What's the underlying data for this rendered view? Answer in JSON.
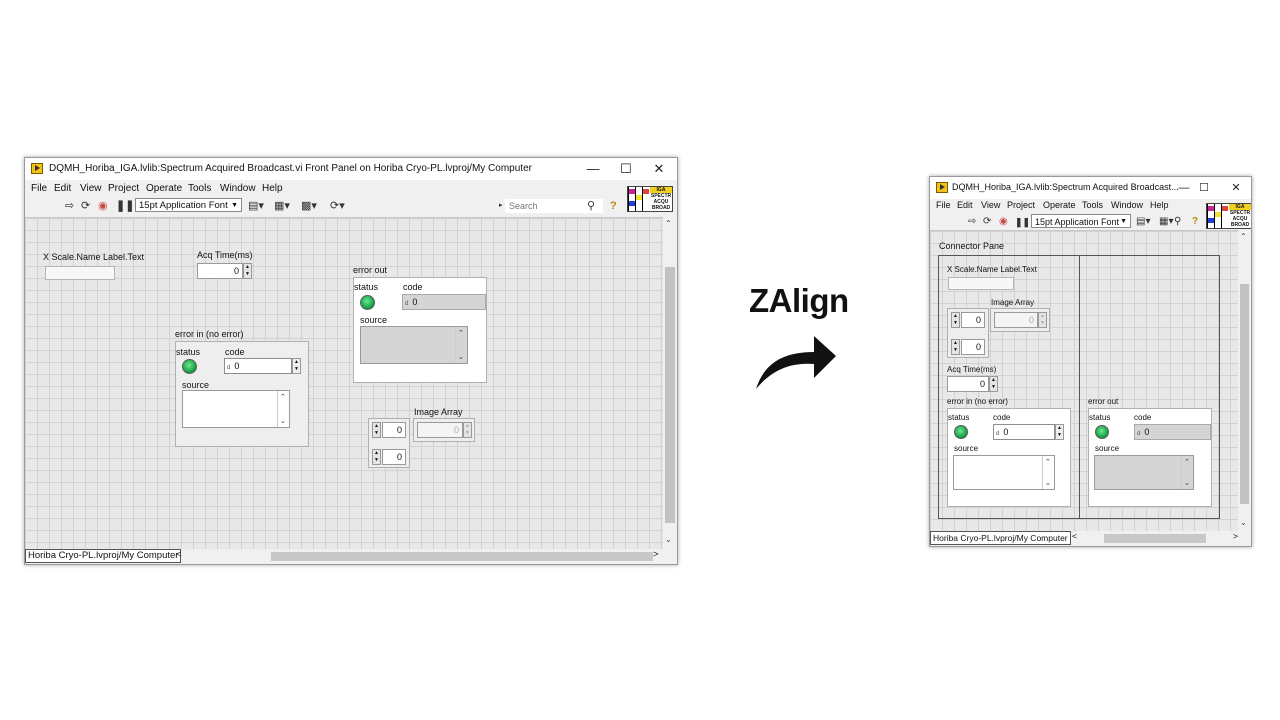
{
  "left_window": {
    "title": "DQMH_Horiba_IGA.lvlib:Spectrum Acquired Broadcast.vi Front Panel on Horiba Cryo-PL.lvproj/My Computer",
    "menu": [
      "File",
      "Edit",
      "View",
      "Project",
      "Operate",
      "Tools",
      "Window",
      "Help"
    ],
    "font_select": "15pt Application Font",
    "search_placeholder": "Search",
    "vi_icon_text": [
      "IGA",
      "SPECTR",
      "ACQU",
      "BROAD"
    ],
    "controls": {
      "x_scale_label": "X Scale.Name Label.Text",
      "acq_time_label": "Acq Time(ms)",
      "acq_time_value": "0",
      "error_in_label": "error in (no error)",
      "error_out_label": "error out",
      "status_label": "status",
      "code_label": "code",
      "source_label": "source",
      "code_value": "0",
      "code_prefix": "d",
      "image_array_label": "Image Array",
      "index_1": "0",
      "index_2": "0",
      "array_value": "0"
    },
    "status_path": "Horiba Cryo-PL.lvproj/My Computer"
  },
  "right_window": {
    "title": "DQMH_Horiba_IGA.lvlib:Spectrum Acquired Broadcast...",
    "menu": [
      "File",
      "Edit",
      "View",
      "Project",
      "Operate",
      "Tools",
      "Window",
      "Help"
    ],
    "font_select": "15pt Application Font",
    "vi_icon_text": [
      "IGA",
      "SPECTR",
      "ACQU",
      "BROAD"
    ],
    "connector_pane_label": "Connector Pane",
    "controls": {
      "x_scale_label": "X Scale.Name Label.Text",
      "image_array_label": "Image Array",
      "index_1": "0",
      "index_2": "0",
      "array_value": "0",
      "acq_time_label": "Acq Time(ms)",
      "acq_time_value": "0",
      "error_in_label": "error in (no error)",
      "error_out_label": "error out",
      "status_label": "status",
      "code_label": "code",
      "source_label": "source",
      "code_value": "0",
      "code_prefix": "d"
    },
    "status_path": "Horiba Cryo-PL.lvproj/My Computer"
  },
  "caption": "ZAlign",
  "colors": {
    "led_green": "#1aa64a",
    "vi_icon_yellow": "#f2c218",
    "panel_grid": "#d2d2d2"
  }
}
